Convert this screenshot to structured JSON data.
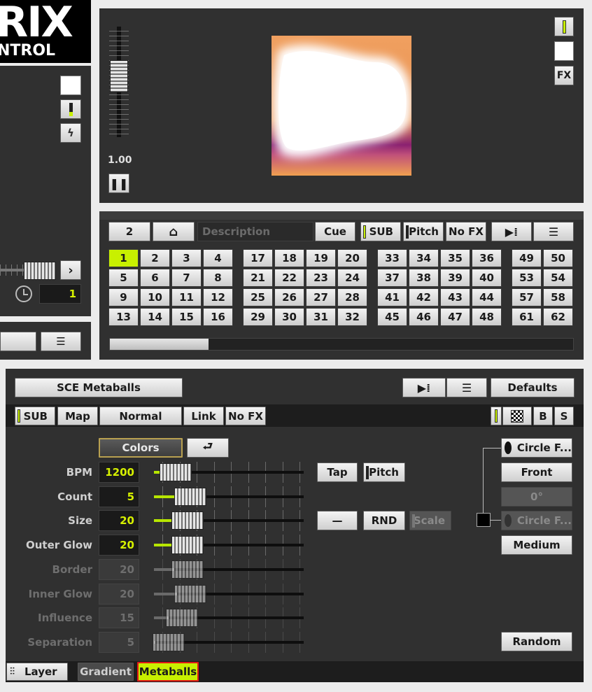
{
  "logo": {
    "line1": "RIX",
    "line2": "NTROL"
  },
  "left_panel": {
    "speed_value": "1"
  },
  "preview": {
    "fader_value": "1.00",
    "fx_label": "FX"
  },
  "cue_bar": {
    "page_number": "2",
    "description_placeholder": "Description",
    "cue_label": "Cue",
    "sub_label": "SUB",
    "pitch_label": "Pitch",
    "nofx_label": "No FX"
  },
  "grid": {
    "groups": [
      [
        "1",
        "2",
        "3",
        "4",
        "5",
        "6",
        "7",
        "8",
        "9",
        "10",
        "11",
        "12",
        "13",
        "14",
        "15",
        "16"
      ],
      [
        "17",
        "18",
        "19",
        "20",
        "21",
        "22",
        "23",
        "24",
        "25",
        "26",
        "27",
        "28",
        "29",
        "30",
        "31",
        "32"
      ],
      [
        "33",
        "34",
        "35",
        "36",
        "37",
        "38",
        "39",
        "40",
        "41",
        "42",
        "43",
        "44",
        "45",
        "46",
        "47",
        "48"
      ],
      [
        "49",
        "50",
        "53",
        "54",
        "57",
        "58",
        "61",
        "62"
      ]
    ],
    "selected": "1"
  },
  "effect": {
    "name": "SCE Metaballs",
    "defaults_label": "Defaults",
    "layer_bar": {
      "sub": "SUB",
      "map": "Map",
      "blend": "Normal",
      "link": "Link",
      "nofx": "No FX",
      "b": "B",
      "s": "S"
    },
    "colors_label": "Colors",
    "params": [
      {
        "label": "BPM",
        "value": "1200",
        "enabled": true,
        "level": 0.05
      },
      {
        "label": "Count",
        "value": "5",
        "enabled": true,
        "level": 0.17
      },
      {
        "label": "Size",
        "value": "20",
        "enabled": true,
        "level": 0.15
      },
      {
        "label": "Outer Glow",
        "value": "20",
        "enabled": true,
        "level": 0.15
      },
      {
        "label": "Border",
        "value": "20",
        "enabled": false,
        "level": 0.15
      },
      {
        "label": "Inner Glow",
        "value": "20",
        "enabled": false,
        "level": 0.17
      },
      {
        "label": "Influence",
        "value": "15",
        "enabled": false,
        "level": 0.1
      },
      {
        "label": "Separation",
        "value": "5",
        "enabled": false,
        "level": 0.0
      }
    ],
    "tap_label": "Tap",
    "pitch_label": "Pitch",
    "dash_label": "—",
    "rnd_label": "RND",
    "scale_label": "Scale",
    "right_buttons": {
      "circle1": "Circle F...",
      "front": "Front",
      "angle": "0°",
      "circle2": "Circle F...",
      "medium": "Medium",
      "random": "Random"
    }
  },
  "tabs": {
    "layer": "Layer",
    "gradient": "Gradient",
    "metaballs": "Metaballs"
  },
  "colors": {
    "accent": "#c8f000",
    "panel": "#303030",
    "active_tab_border": "#e01818"
  }
}
